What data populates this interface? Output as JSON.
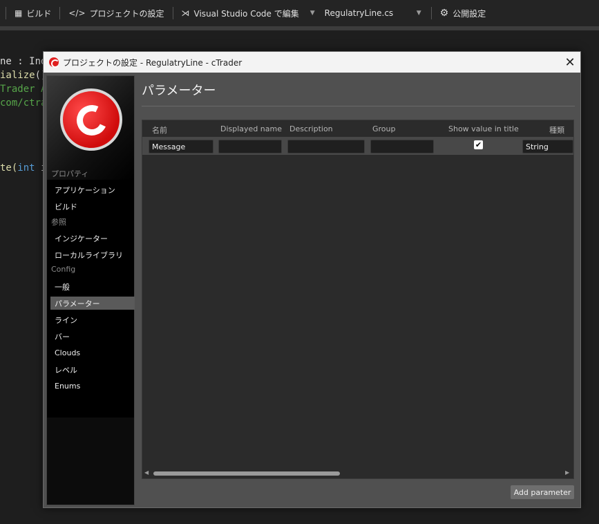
{
  "toolbar": {
    "build_label": "ビルド",
    "project_settings_label": "プロジェクトの設定",
    "vscode_label": "Visual Studio Code で編集",
    "file_selected": "RegulatryLine.cs",
    "publish_label": "公開設定"
  },
  "code": {
    "line1": "ne : Indi",
    "line2a": "ialize",
    "line2b": "()",
    "line3": "Trader A",
    "line4": "com/ctrad",
    "line5a": "te(",
    "line5b": "int",
    "line5c": " i"
  },
  "dialog": {
    "title": "プロジェクトの設定 - RegulatryLine - cTrader",
    "close": "✕"
  },
  "sidebar": {
    "groups": [
      "プロパティ",
      "参照",
      "Config"
    ],
    "items": [
      "アプリケーション",
      "ビルド",
      "インジケーター",
      "ローカルライブラリ",
      "一般",
      "パラメーター",
      "ライン",
      "バー",
      "Clouds",
      "レベル",
      "Enums"
    ],
    "active": "パラメーター"
  },
  "content": {
    "title": "パラメーター",
    "columns": [
      "名前",
      "Displayed name",
      "Description",
      "Group",
      "Show value in title",
      "種類"
    ],
    "rows": [
      {
        "name": "Message",
        "displayed_name": "",
        "description": "",
        "group": "",
        "show_value_in_title": true,
        "type": "String"
      }
    ],
    "checkmark": "✔",
    "add_button": "Add parameter"
  },
  "colors": {
    "accent_red": "#e02020",
    "active_item": "#5a5a5a"
  }
}
